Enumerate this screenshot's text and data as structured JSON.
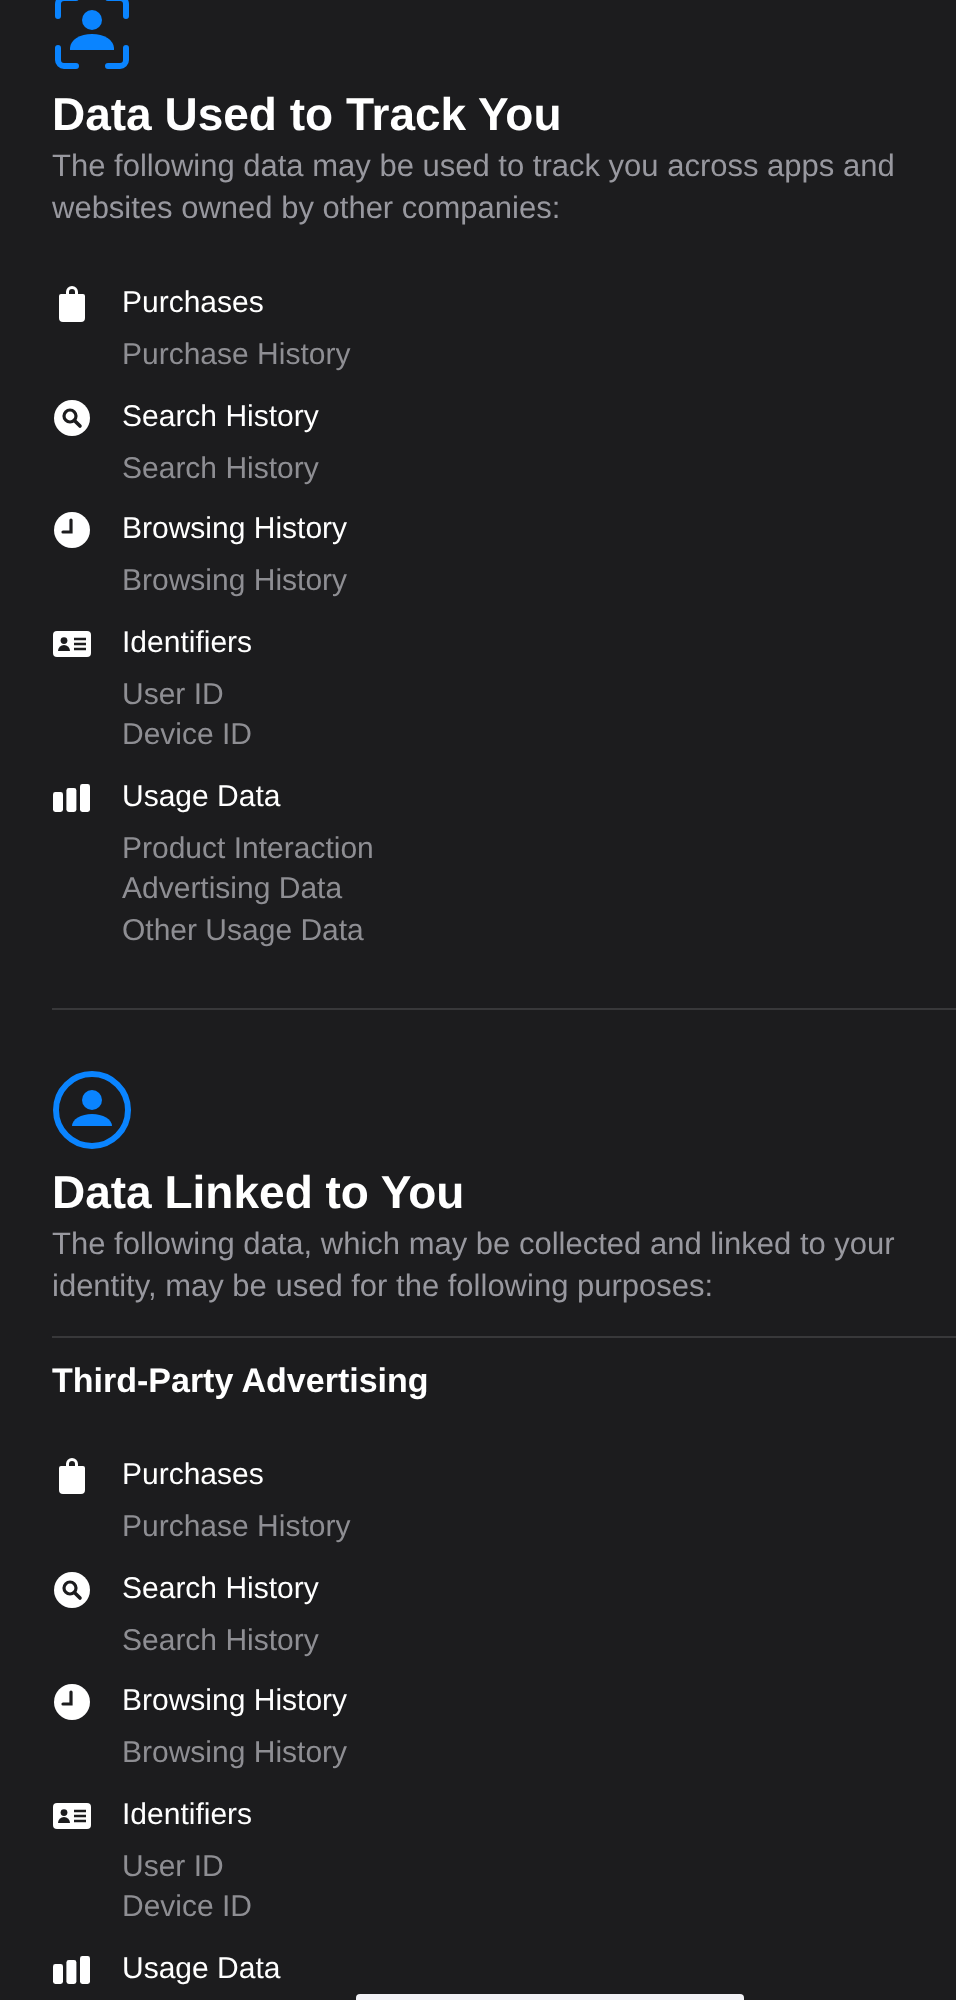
{
  "sections": [
    {
      "kind": "tracking",
      "title": "Data Used to Track You",
      "description": "The following data may be used to track you across apps and websites owned by other companies:",
      "groups": [
        {
          "items": [
            {
              "kind": "bag",
              "label": "Purchases",
              "details": [
                "Purchase History"
              ]
            },
            {
              "kind": "search",
              "label": "Search History",
              "details": [
                "Search History"
              ]
            },
            {
              "kind": "clock",
              "label": "Browsing History",
              "details": [
                "Browsing History"
              ]
            },
            {
              "kind": "card",
              "label": "Identifiers",
              "details": [
                "User ID",
                "Device ID"
              ]
            },
            {
              "kind": "bars",
              "label": "Usage Data",
              "details": [
                "Product Interaction",
                "Advertising Data",
                "Other Usage Data"
              ]
            }
          ]
        }
      ]
    },
    {
      "kind": "linked",
      "title": "Data Linked to You",
      "description": "The following data, which may be collected and linked to your identity, may be used for the following purposes:",
      "groups": [
        {
          "heading": "Third-Party Advertising",
          "items": [
            {
              "kind": "bag",
              "label": "Purchases",
              "details": [
                "Purchase History"
              ]
            },
            {
              "kind": "search",
              "label": "Search History",
              "details": [
                "Search History"
              ]
            },
            {
              "kind": "clock",
              "label": "Browsing History",
              "details": [
                "Browsing History"
              ]
            },
            {
              "kind": "card",
              "label": "Identifiers",
              "details": [
                "User ID",
                "Device ID"
              ]
            },
            {
              "kind": "bars",
              "label": "Usage Data"
            }
          ]
        }
      ]
    }
  ]
}
